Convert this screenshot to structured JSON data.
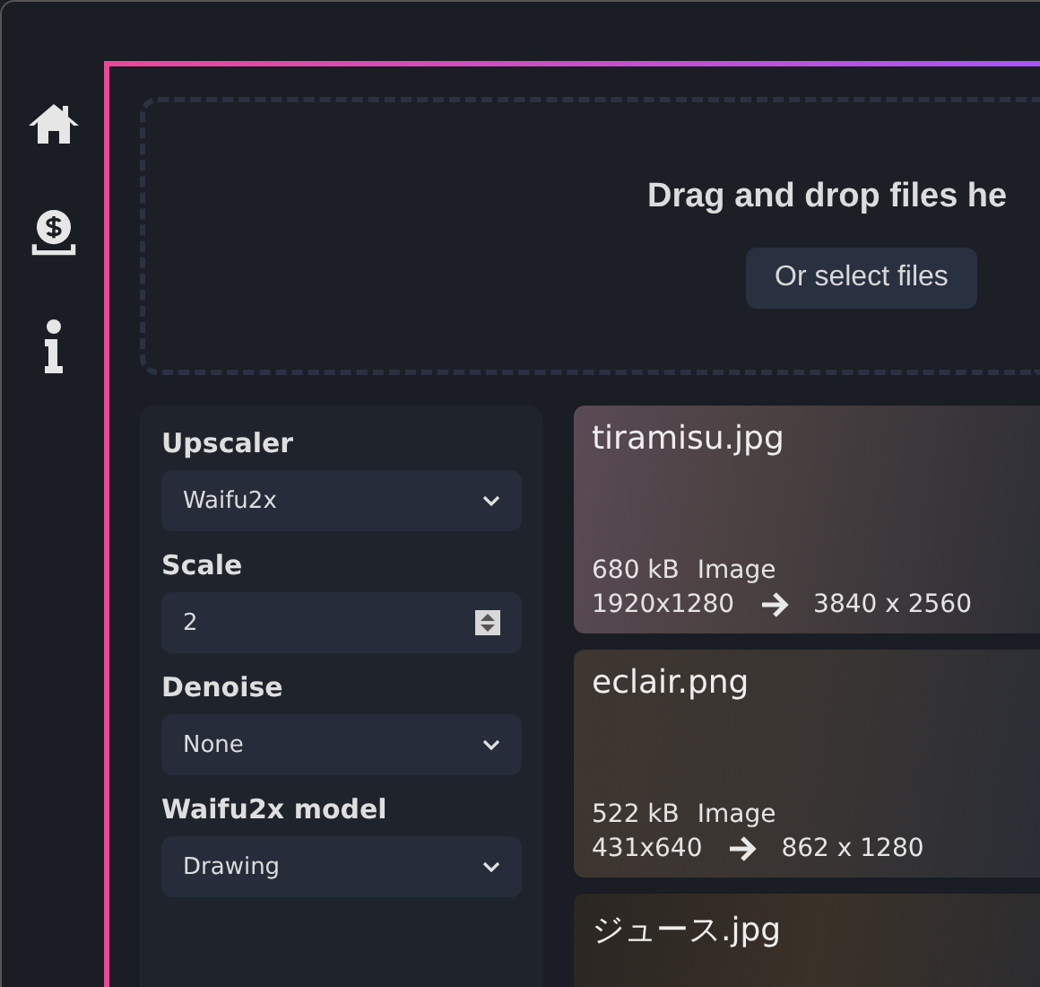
{
  "sidebar": {
    "items": [
      {
        "kind": "home"
      },
      {
        "kind": "donate"
      },
      {
        "kind": "info"
      }
    ]
  },
  "dropzone": {
    "title": "Drag and drop files he",
    "button": "Or select files"
  },
  "settings": [
    {
      "kind": "select",
      "label": "Upscaler",
      "value": "Waifu2x"
    },
    {
      "kind": "number",
      "label": "Scale",
      "value": "2"
    },
    {
      "kind": "select",
      "label": "Denoise",
      "value": "None"
    },
    {
      "kind": "select",
      "label": "Waifu2x model",
      "value": "Drawing"
    }
  ],
  "files": [
    {
      "name": "tiramisu.jpg",
      "size": "680 kB",
      "type": "Image",
      "from": "1920x1280",
      "to": "3840 x 2560"
    },
    {
      "name": "eclair.png",
      "size": "522 kB",
      "type": "Image",
      "from": "431x640",
      "to": "862 x 1280"
    },
    {
      "name": "ジュース.jpg"
    }
  ]
}
